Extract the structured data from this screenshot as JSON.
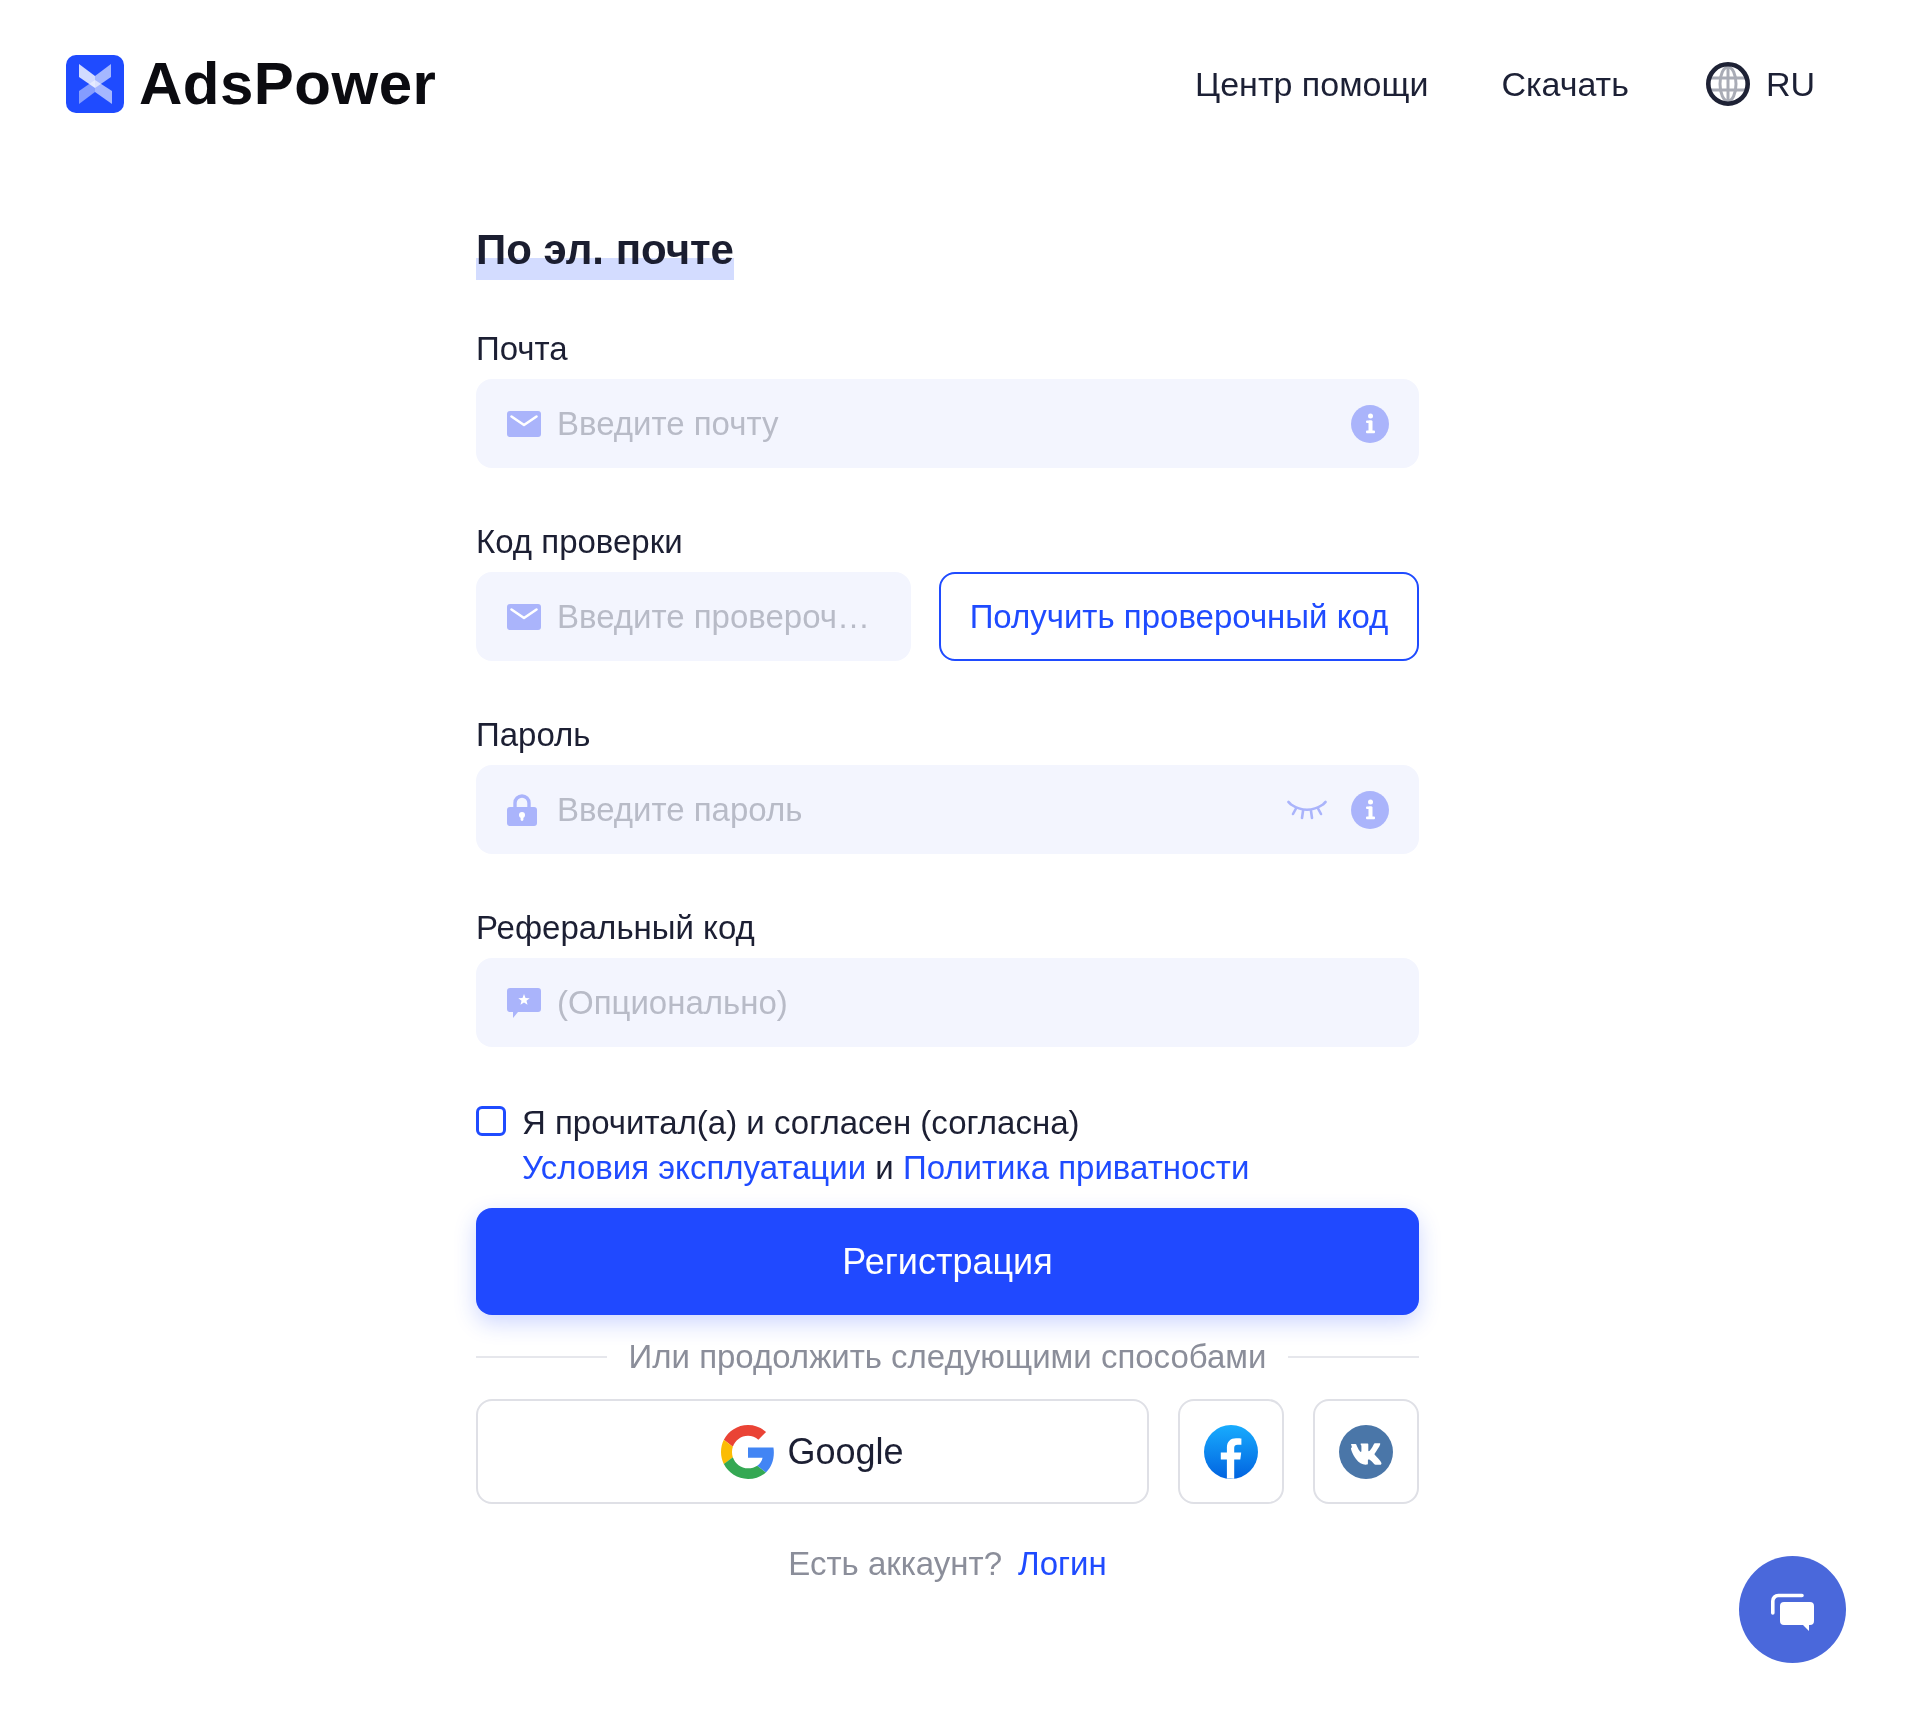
{
  "header": {
    "logo": "AdsPower",
    "nav": [
      {
        "label": "Центр помощи"
      },
      {
        "label": "Скачать"
      }
    ],
    "language": "RU"
  },
  "form": {
    "title": "По эл. почте",
    "fields": [
      {
        "kind": "email",
        "label": "Почта",
        "placeholder": "Введите почту",
        "info": true
      },
      {
        "kind": "code",
        "label": "Код проверки",
        "placeholder": "Введите провероч…",
        "info": false,
        "button": "Получить проверочный код"
      },
      {
        "kind": "password",
        "label": "Пароль",
        "placeholder": "Введите пароль",
        "info": true,
        "revealed": false
      },
      {
        "kind": "referral",
        "label": "Реферальный код",
        "placeholder": "(Опционально)",
        "info": false
      }
    ],
    "agreement": {
      "checked": false,
      "parts": [
        {
          "kind": "text",
          "text": "Я прочитал(а) и согласен (согласна)"
        },
        {
          "kind": "link",
          "text": "Условия эксплуатации"
        },
        {
          "kind": "text",
          "text": "и"
        },
        {
          "kind": "link",
          "text": "Политика приватности"
        }
      ]
    },
    "submit": "Регистрация",
    "divider": "Или продолжить следующими способами",
    "social": [
      {
        "kind": "google",
        "label": "Google"
      },
      {
        "kind": "facebook"
      },
      {
        "kind": "vk"
      }
    ],
    "login_prompt": {
      "text": "Есть аккаунт?",
      "link": "Логин"
    }
  }
}
